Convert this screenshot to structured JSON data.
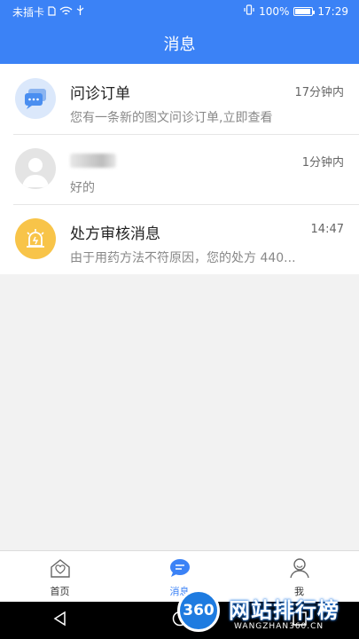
{
  "status_bar": {
    "carrier": "未插卡",
    "battery": "100%",
    "time": "17:29"
  },
  "header": {
    "title": "消息"
  },
  "messages": [
    {
      "title": "问诊订单",
      "time": "17分钟内",
      "preview": "您有一条新的图文问诊订单,立即查看",
      "icon": "chat-bubble-icon"
    },
    {
      "title": "",
      "time": "1分钟内",
      "preview": "好的",
      "icon": "user-avatar-icon"
    },
    {
      "title": "处方审核消息",
      "time": "14:47",
      "preview": "由于用药方法不符原因，您的处方 440...",
      "icon": "alarm-icon"
    }
  ],
  "tabs": [
    {
      "label": "首页",
      "icon": "home-icon"
    },
    {
      "label": "消息",
      "icon": "message-icon",
      "active": true
    },
    {
      "label": "我",
      "icon": "user-icon"
    }
  ],
  "watermark": {
    "logo": "360",
    "text": "网站排行榜",
    "sub": "WANGZHAN360.CN"
  },
  "colors": {
    "primary": "#3b82f6",
    "prescription": "#f8c449"
  }
}
